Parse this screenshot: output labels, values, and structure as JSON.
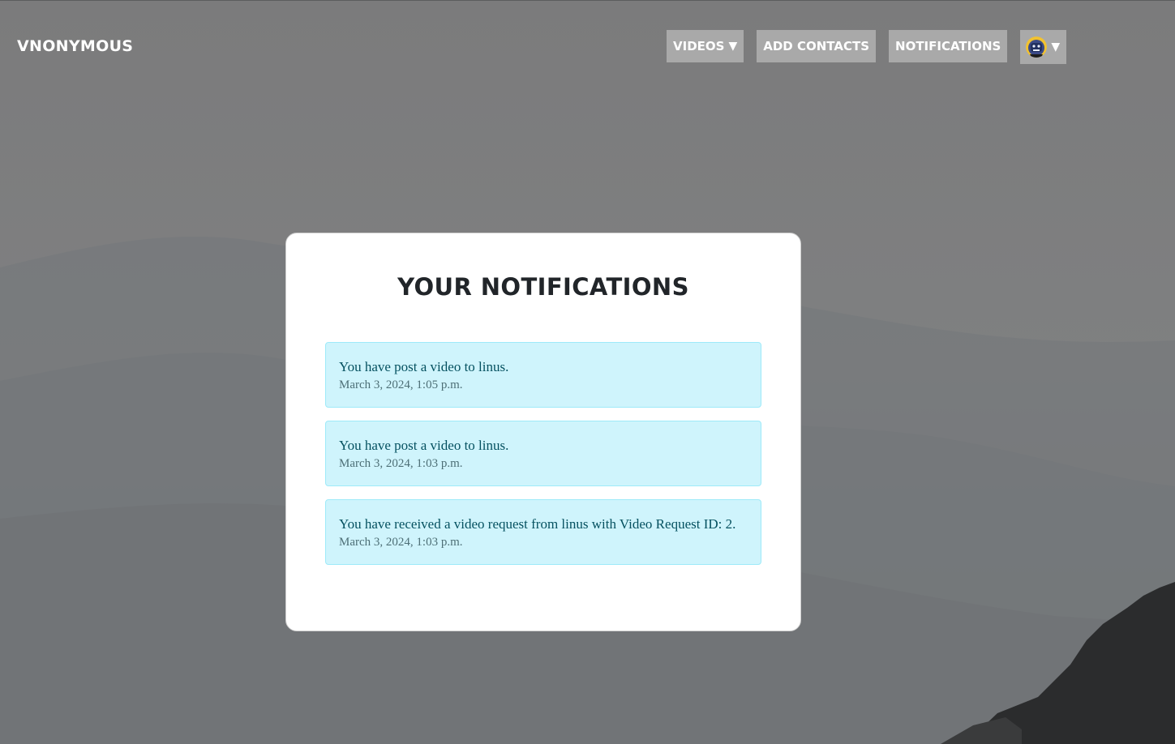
{
  "header": {
    "brand": "VNONYMOUS",
    "nav": {
      "videos_label": "VIDEOS",
      "add_contacts_label": "ADD CONTACTS",
      "notifications_label": "NOTIFICATIONS",
      "caret_glyph": "▼",
      "avatar_icon": "user-avatar-icon"
    }
  },
  "main": {
    "title": "YOUR NOTIFICATIONS",
    "notifications": [
      {
        "message": "You have post a video to linus.",
        "timestamp": "March 3, 2024, 1:05 p.m."
      },
      {
        "message": "You have post a video to linus.",
        "timestamp": "March 3, 2024, 1:03 p.m."
      },
      {
        "message": "You have received a video request from linus with Video Request ID: 2.",
        "timestamp": "March 3, 2024, 1:03 p.m."
      }
    ]
  },
  "colors": {
    "nav_button_bg": "#a9a9a9",
    "notification_bg": "#cff4fc",
    "notification_border": "#9eeaf9",
    "notification_text": "#055160",
    "card_bg": "#ffffff"
  }
}
